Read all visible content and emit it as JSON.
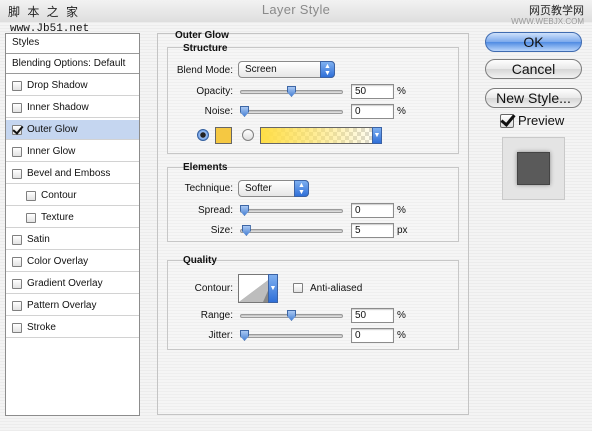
{
  "window": {
    "title": "Layer Style",
    "watermark_left": "脚 本 之 家",
    "watermark_site": "www.Jb51.net",
    "watermark_right": "网页教学网",
    "watermark_right_small": "WWW.WEBJX.COM"
  },
  "styles_list": {
    "header": "Styles",
    "blending": "Blending Options: Default",
    "items": [
      {
        "label": "Drop Shadow",
        "checked": false,
        "selected": false,
        "indent": false
      },
      {
        "label": "Inner Shadow",
        "checked": false,
        "selected": false,
        "indent": false
      },
      {
        "label": "Outer Glow",
        "checked": true,
        "selected": true,
        "indent": false
      },
      {
        "label": "Inner Glow",
        "checked": false,
        "selected": false,
        "indent": false
      },
      {
        "label": "Bevel and Emboss",
        "checked": false,
        "selected": false,
        "indent": false
      },
      {
        "label": "Contour",
        "checked": false,
        "selected": false,
        "indent": true
      },
      {
        "label": "Texture",
        "checked": false,
        "selected": false,
        "indent": true
      },
      {
        "label": "Satin",
        "checked": false,
        "selected": false,
        "indent": false
      },
      {
        "label": "Color Overlay",
        "checked": false,
        "selected": false,
        "indent": false
      },
      {
        "label": "Gradient Overlay",
        "checked": false,
        "selected": false,
        "indent": false
      },
      {
        "label": "Pattern Overlay",
        "checked": false,
        "selected": false,
        "indent": false
      },
      {
        "label": "Stroke",
        "checked": false,
        "selected": false,
        "indent": false
      }
    ]
  },
  "outer_glow": {
    "title": "Outer Glow",
    "structure": {
      "title": "Structure",
      "blend_mode_label": "Blend Mode:",
      "blend_mode_value": "Screen",
      "opacity_label": "Opacity:",
      "opacity_value": "50",
      "opacity_level": 50,
      "opacity_unit": "%",
      "noise_label": "Noise:",
      "noise_value": "0",
      "noise_level": 0,
      "noise_unit": "%",
      "color_mode": "solid",
      "glow_color": "#f5c842"
    },
    "elements": {
      "title": "Elements",
      "technique_label": "Technique:",
      "technique_value": "Softer",
      "spread_label": "Spread:",
      "spread_value": "0",
      "spread_level": 0,
      "spread_unit": "%",
      "size_label": "Size:",
      "size_value": "5",
      "size_level": 2,
      "size_unit": "px"
    },
    "quality": {
      "title": "Quality",
      "contour_label": "Contour:",
      "anti_aliased_label": "Anti-aliased",
      "anti_aliased": false,
      "range_label": "Range:",
      "range_value": "50",
      "range_level": 50,
      "range_unit": "%",
      "jitter_label": "Jitter:",
      "jitter_value": "0",
      "jitter_level": 0,
      "jitter_unit": "%"
    }
  },
  "buttons": {
    "ok": "OK",
    "cancel": "Cancel",
    "new_style": "New Style...",
    "preview_label": "Preview",
    "preview_checked": true
  }
}
